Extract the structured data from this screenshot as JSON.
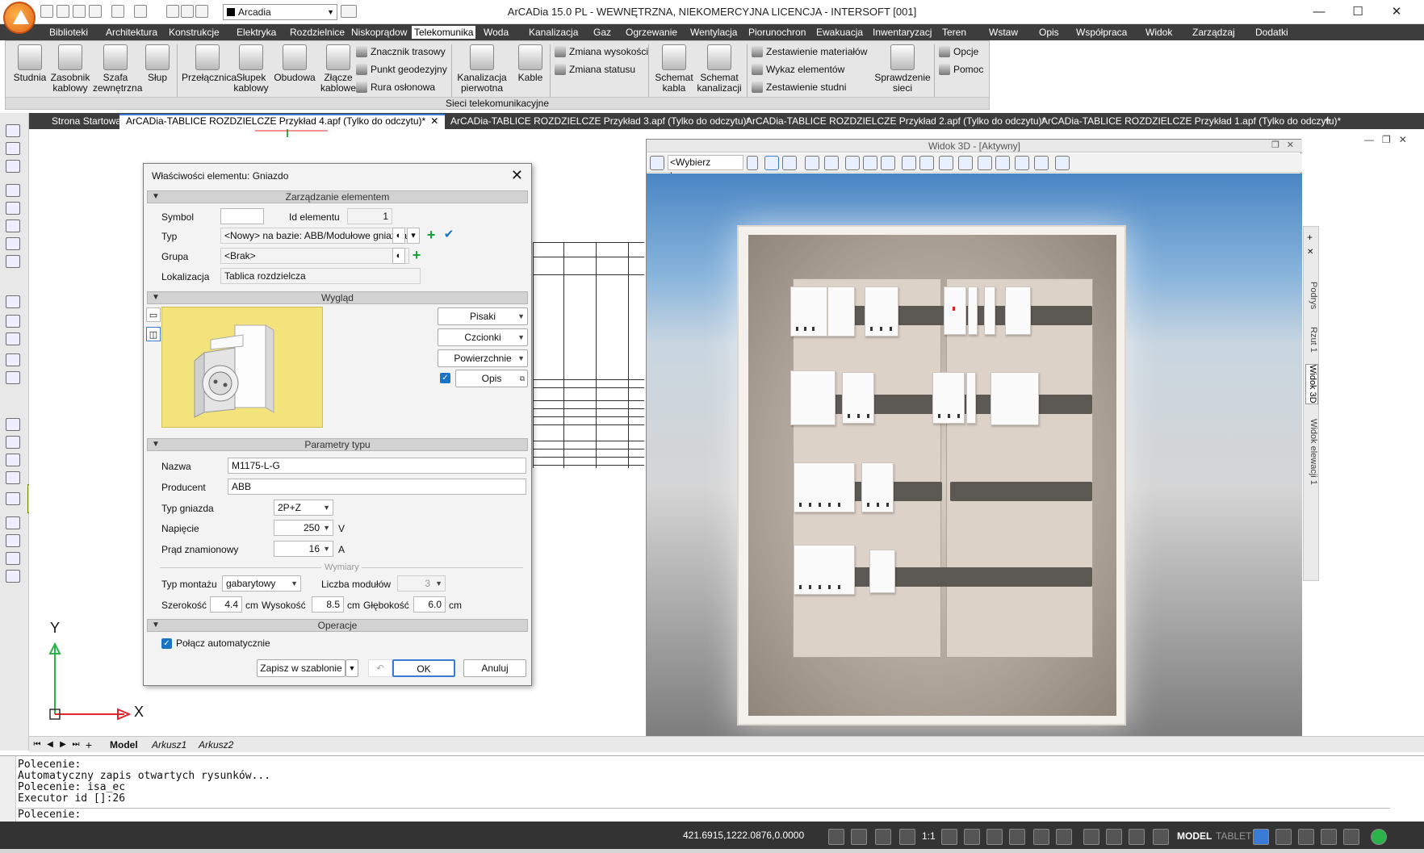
{
  "app": {
    "title": "ArCADia 15.0 PL - WEWNĘTRZNA, NIEKOMERCYJNA LICENCJA - INTERSOFT [001]",
    "layer": "Arcadia"
  },
  "menu": {
    "items": [
      "Biblioteki",
      "Architektura",
      "Konstrukcje",
      "Elektryka",
      "Rozdzielnice",
      "Niskoprądow",
      "Telekomunika",
      "Woda",
      "Kanalizacja",
      "Gaz",
      "Ogrzewanie",
      "Wentylacja",
      "Piorunochron",
      "Ewakuacja",
      "Inwentaryzacj",
      "Teren",
      "Wstaw",
      "Opis",
      "Współpraca",
      "Widok",
      "Zarządzaj",
      "Dodatki"
    ],
    "active": "Telekomunika"
  },
  "ribbon": {
    "big": [
      "Studnia",
      "Zasobnik\nkablowy",
      "Szafa\nzewnętrzna",
      "Słup",
      "Przełącznica",
      "Słupek\nkablowy",
      "Obudowa",
      "Złącze\nkablowe",
      "Kanalizacja\npierwotna",
      "Kable",
      "Schemat\nkabla",
      "Schemat\nkanalizacji",
      "Sprawdzenie\nsieci"
    ],
    "small": [
      "Znacznik trasowy",
      "Punkt geodezyjny",
      "Rura osłonowa",
      "Zmiana wysokości",
      "Zmiana statusu",
      "Zestawienie materiałów",
      "Wykaz elementów",
      "Zestawienie studni",
      "Opcje",
      "Pomoc"
    ],
    "group": "Sieci telekomunikacyjne"
  },
  "doctabs": [
    {
      "label": "Strona Startowa",
      "active": false
    },
    {
      "label": "ArCADia-TABLICE ROZDZIELCZE Przykład 4.apf (Tylko do odczytu)*",
      "active": true
    },
    {
      "label": "ArCADia-TABLICE ROZDZIELCZE Przykład 3.apf (Tylko do odczytu)*",
      "active": false
    },
    {
      "label": "ArCADia-TABLICE ROZDZIELCZE Przykład 2.apf (Tylko do odczytu)*",
      "active": false
    },
    {
      "label": "ArCADia-TABLICE ROZDZIELCZE Przykład 1.apf (Tylko do odczytu)*",
      "active": false
    }
  ],
  "dialog": {
    "title": "Właściwości elementu: Gniazdo",
    "sections": {
      "management": "Zarządzanie elementem",
      "appearance": "Wygląd",
      "type_params": "Parametry typu",
      "dimensions": "Wymiary",
      "operations": "Operacje"
    },
    "management": {
      "symbol_label": "Symbol",
      "symbol_value": "",
      "id_label": "Id elementu",
      "id_value": "1",
      "type_label": "Typ",
      "type_value": "<Nowy> na bazie: ABB/Modułowe gniazda",
      "group_label": "Grupa",
      "group_value": "<Brak>",
      "location_label": "Lokalizacja",
      "location_value": "Tablica rozdzielcza"
    },
    "appearance": {
      "pens": "Pisaki",
      "fonts": "Czcionki",
      "surfaces": "Powierzchnie",
      "description": "Opis"
    },
    "params": {
      "name_label": "Nazwa",
      "name_value": "M1175-L-G",
      "producer_label": "Producent",
      "producer_value": "ABB",
      "socket_type_label": "Typ gniazda",
      "socket_type_value": "2P+Z",
      "voltage_label": "Napięcie",
      "voltage_value": "250",
      "voltage_unit": "V",
      "current_label": "Prąd znamionowy",
      "current_value": "16",
      "current_unit": "A",
      "mount_label": "Typ montażu",
      "mount_value": "gabarytowy",
      "modules_label": "Liczba modułów",
      "modules_value": "3",
      "width_label": "Szerokość",
      "width_value": "4.4",
      "height_label": "Wysokość",
      "height_value": "8.5",
      "depth_label": "Głębokość",
      "depth_value": "6.0",
      "unit_cm": "cm"
    },
    "operations": {
      "auto_connect": "Połącz automatycznie"
    },
    "buttons": {
      "save_template": "Zapisz w szablonie",
      "ok": "OK",
      "cancel": "Anuluj"
    }
  },
  "view3d": {
    "title": "Widok 3D - [Aktywny]",
    "camera_placeholder": "<Wybierz kamerę>",
    "side_tabs": [
      "Podrys",
      "Rzut 1",
      "Widok 3D",
      "Widok elewacji 1"
    ]
  },
  "axes": {
    "y": "Y",
    "x": "X"
  },
  "sheets": {
    "items": [
      "Model",
      "Arkusz1",
      "Arkusz2"
    ],
    "active": "Model"
  },
  "command": {
    "history": [
      "Polecenie:",
      "Automatyczny zapis otwartych rysunków...",
      "Polecenie: isa_ec",
      "Executor id []:26"
    ],
    "prompt": "Polecenie:"
  },
  "status": {
    "coords": "421.6915,1222.0876,0.0000",
    "scale": "1:1",
    "model": "MODEL",
    "tablet": "TABLET"
  }
}
